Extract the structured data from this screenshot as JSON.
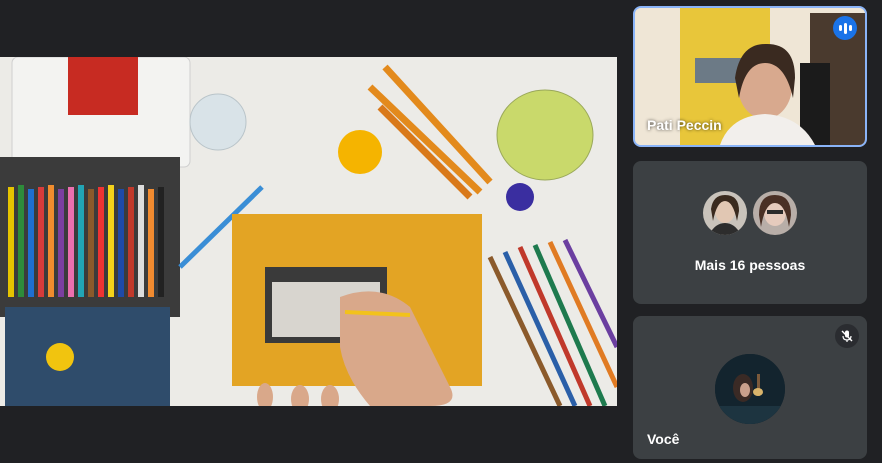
{
  "participants": {
    "active_speaker": {
      "name": "Pati Peccin",
      "status_icon": "speaking-icon"
    },
    "more_people": {
      "label": "Mais 16 pessoas"
    },
    "self": {
      "name": "Você",
      "status_icon": "mic-off-icon"
    }
  },
  "colors": {
    "background": "#202124",
    "tile": "#3c4043",
    "active_border": "#8ab4f8",
    "speaking_badge": "#1a73e8"
  }
}
